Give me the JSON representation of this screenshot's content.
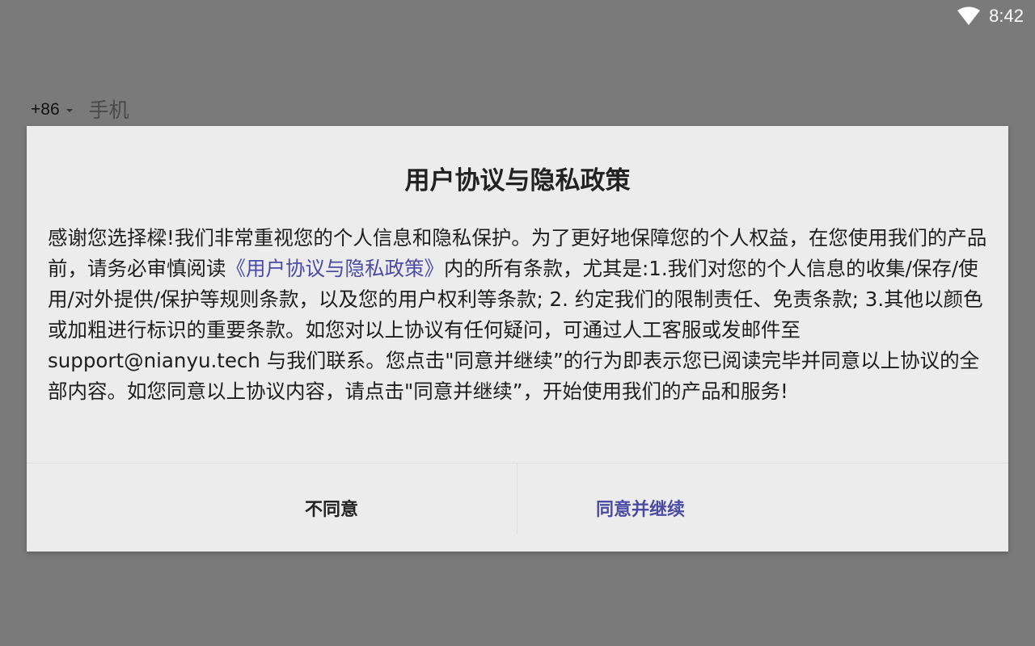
{
  "status_bar": {
    "time": "8:42",
    "wifi_icon": "wifi-icon"
  },
  "login": {
    "country_code": "+86",
    "phone_placeholder": "手机"
  },
  "dialog": {
    "title": "用户协议与隐私政策",
    "body": {
      "part1": "感谢您选择樑!我们非常重视您的个人信息和隐私保护。为了更好地保障您的个人权益，在您使用我们的产品前，请务必审慎阅读",
      "link": "《用户协议与隐私政策》",
      "part2": "内的所有条款，尤其是:1.我们对您的个人信息的收集/保存/使用/对外提供/保护等规则条款，以及您的用户权利等条款; 2. 约定我们的限制责任、免责条款; 3.其他以颜色或加粗进行标识的重要条款。如您对以上协议有任何疑问，可通过人工客服或发邮件至 support@nianyu.tech 与我们联系。您点击\"同意并继续”的行为即表示您已阅读完毕并同意以上协议的全部内容。如您同意以上协议内容，请点击\"同意并继续”，开始使用我们的产品和服务!"
    },
    "disagree_label": "不同意",
    "agree_label": "同意并继续"
  },
  "colors": {
    "overlay": "#7a7a7a",
    "dialog_bg": "#ececec",
    "accent": "#4b4ba6"
  }
}
